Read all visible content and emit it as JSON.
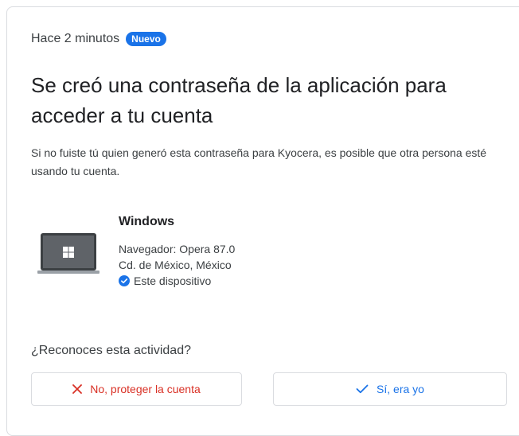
{
  "notification": {
    "time": "Hace 2 minutos",
    "badge": "Nuevo",
    "headline": "Se creó una contraseña de la aplicación para acceder a tu cuenta",
    "body": "Si no fuiste tú quien generó esta contraseña para Kyocera, es posible que otra persona esté usando tu cuenta."
  },
  "device": {
    "name": "Windows",
    "browser": "Navegador: Opera 87.0",
    "location": "Cd. de México, México",
    "this_device": "Este dispositivo",
    "icon": "windows-laptop-icon"
  },
  "prompt": {
    "question": "¿Reconoces esta actividad?",
    "no_label": "No, proteger la cuenta",
    "yes_label": "Sí, era yo"
  },
  "colors": {
    "accent": "#1a73e8",
    "danger": "#d93025",
    "border": "#dadce0"
  }
}
